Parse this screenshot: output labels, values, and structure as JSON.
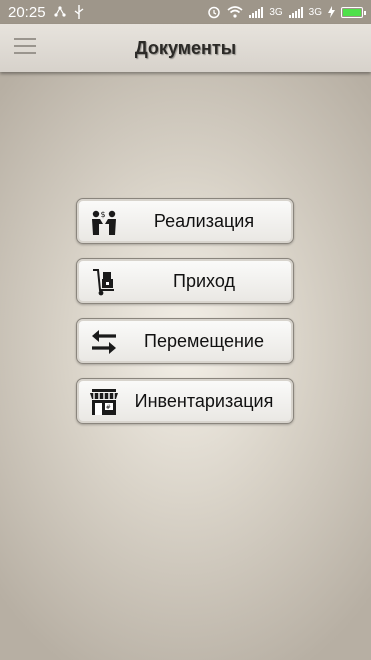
{
  "status": {
    "time": "20:25",
    "net1": "3G",
    "net2": "3G"
  },
  "appbar": {
    "title": "Документы"
  },
  "menu": [
    {
      "label": "Реализация",
      "icon": "people-exchange-money-icon"
    },
    {
      "label": "Приход",
      "icon": "hand-truck-boxes-icon"
    },
    {
      "label": "Перемещение",
      "icon": "swap-arrows-icon"
    },
    {
      "label": "Инвентаризация",
      "icon": "store-front-icon"
    }
  ]
}
